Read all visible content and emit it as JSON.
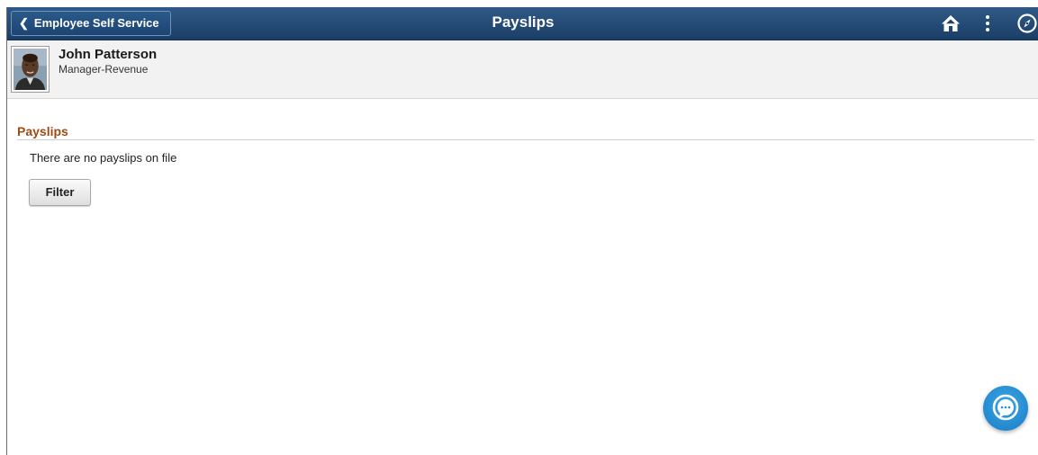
{
  "header": {
    "back_label": "Employee Self Service",
    "title": "Payslips",
    "icons": {
      "back": "chevron-left-icon",
      "home": "home-icon",
      "menu": "vertical-dots-icon",
      "nav": "compass-icon"
    }
  },
  "user": {
    "name": "John Patterson",
    "role": "Manager-Revenue"
  },
  "section": {
    "title": "Payslips",
    "empty_message": "There are no payslips on file",
    "filter_label": "Filter"
  },
  "chat": {
    "icon": "chat-bubble-icon"
  },
  "colors": {
    "header_bg": "#1f4670",
    "section_title": "#9c4d14",
    "banner_bg": "#f2f2f2",
    "chat_bg": "#2592d6"
  }
}
